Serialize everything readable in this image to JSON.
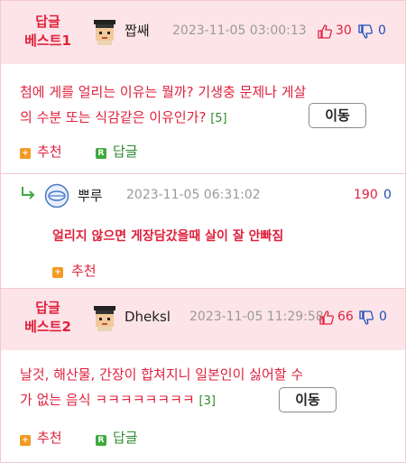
{
  "best1": {
    "badge_line1": "답글",
    "badge_line2": "베스트1",
    "nickname": "짭쌔",
    "timestamp": "2023-11-05 03:00:13",
    "up_count": "30",
    "down_count": "0",
    "comment_line1": "첨에 게를 얼리는 이유는 뭘까? 기생충 문제나 게살",
    "comment_line2": "의 수분 또는 식감같은 이유인가?",
    "reply_count": "[5]",
    "move_label": "이동",
    "recommend_label": "추천",
    "reply_label": "답글"
  },
  "reply": {
    "nickname": "뿌루",
    "timestamp": "2023-11-05 06:31:02",
    "up_count": "190",
    "down_count": "0",
    "comment": "얼리지 않으면 게장담갔을때 살이 잘 안빠짐",
    "recommend_label": "추천"
  },
  "best2": {
    "badge_line1": "답글",
    "badge_line2": "베스트2",
    "nickname": "Dheksl",
    "timestamp": "2023-11-05 11:29:58",
    "up_count": "66",
    "down_count": "0",
    "comment_line1": "날것, 해산물, 간장이 합쳐지니 일본인이 싫어할 수",
    "comment_line2": "가 없는 음식 ㅋㅋㅋㅋㅋㅋㅋㅋ",
    "reply_count": "[3]",
    "move_label": "이동",
    "recommend_label": "추천",
    "reply_label": "답글"
  },
  "icons": {
    "thumbs_up": "thumbs-up-icon",
    "thumbs_down": "thumbs-down-icon",
    "plus": "plus-icon",
    "reply_r": "reply-r-icon",
    "reply_arrow": "reply-arrow-icon"
  },
  "colors": {
    "accent_red": "#e0213c",
    "down_blue": "#1f4fb8",
    "reply_green": "#2f8a2f",
    "header_bg": "#fde4e8"
  }
}
